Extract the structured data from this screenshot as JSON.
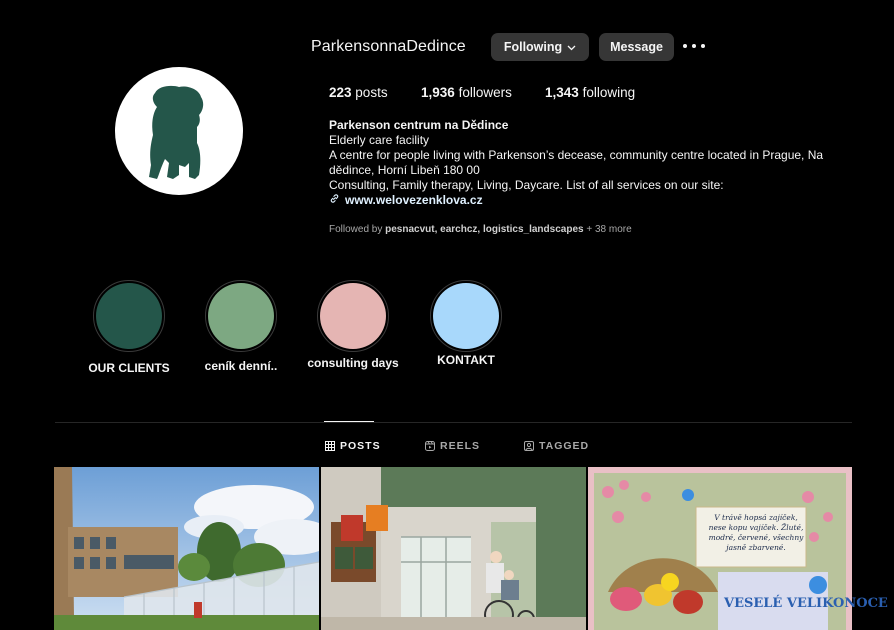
{
  "header": {
    "username": "ParkensonnaDedince",
    "following_label": "Following",
    "message_label": "Message"
  },
  "stats": {
    "posts_count": "223",
    "posts_label": "posts",
    "followers_count": "1,936",
    "followers_label": "followers",
    "following_count": "1,343",
    "following_label": "following"
  },
  "bio": {
    "name": "Parkenson centrum na Dědince",
    "category": "Elderly care facility",
    "line1": "A centre for people living with Parkenson’s decease, community centre located in Prague, Na dědince, Horní Libeň 180 00",
    "line2": "Consulting, Family therapy, Living, Daycare. List of all services on our site:",
    "link": "www.welovezenklova.cz"
  },
  "followed_by": {
    "prefix": "Followed by",
    "names": "pesnacvut, earchcz, logistics_landscapes",
    "suffix": "+ 38 more"
  },
  "highlights": [
    {
      "label": "OUR CLIENTS",
      "color": "#24564a"
    },
    {
      "label": "ceník denní..",
      "color": "#7da882"
    },
    {
      "label": "consulting days",
      "color": "#e5b5b3"
    },
    {
      "label": "KONTAKT",
      "color": "#a8d8fb"
    }
  ],
  "tabs": [
    {
      "label": "POSTS",
      "icon": "grid-icon"
    },
    {
      "label": "REELS",
      "icon": "reels-icon"
    },
    {
      "label": "TAGGED",
      "icon": "tagged-icon"
    }
  ],
  "posts": {
    "easter_poem": "V trávě hopsá zajíček, nese kopu vajíček. Žluté, modré, červené, všechny jasně zbarvené.",
    "easter_title": "VESELÉ VELIKONOCE"
  },
  "colors": {
    "avatar_dog": "#24564a",
    "link": "#e0f1ff",
    "button_bg": "#363636"
  }
}
